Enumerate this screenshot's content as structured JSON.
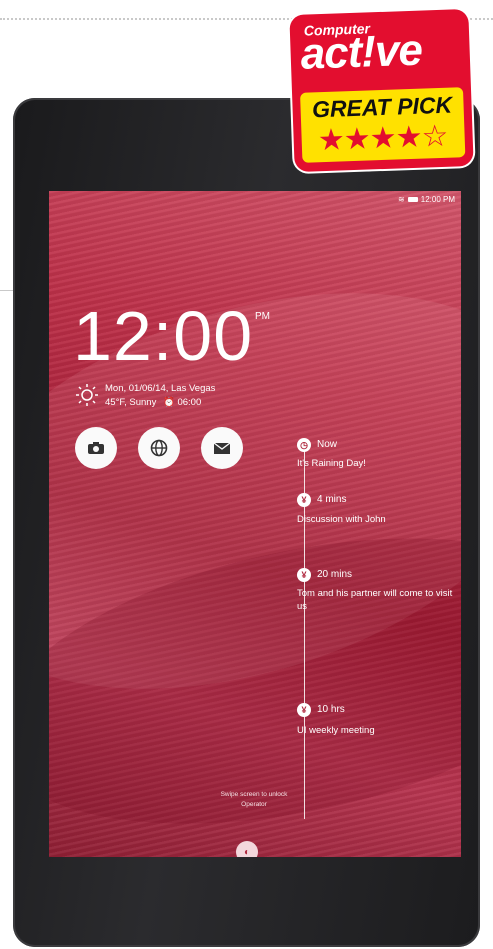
{
  "badge": {
    "brand_small": "Computer",
    "brand_large": "act!ve",
    "label": "GREAT PICK",
    "rating": 4,
    "rating_max": 5,
    "colors": {
      "red": "#e30e2f",
      "yellow": "#ffe100"
    }
  },
  "status_bar": {
    "time": "12:00 PM",
    "icons": [
      "wifi-icon",
      "battery-icon"
    ]
  },
  "lockscreen": {
    "clock": "12:00",
    "ampm": "PM",
    "date_location": "Mon, 01/06/14, Las Vegas",
    "weather": "45°F, Sunny",
    "alarm": "06:00",
    "weather_icon": "sun-icon",
    "quick_actions": [
      {
        "name": "camera",
        "icon": "camera-icon"
      },
      {
        "name": "browser",
        "icon": "globe-icon"
      },
      {
        "name": "mail",
        "icon": "mail-icon"
      }
    ],
    "events": [
      {
        "time": "Now",
        "desc": "It's Raining Day!",
        "icon": "clock-icon"
      },
      {
        "time": "4 mins",
        "desc": "Discussion with John",
        "icon": "event-icon"
      },
      {
        "time": "20 mins",
        "desc": "Tom and his partner will come to visit us",
        "icon": "event-icon"
      },
      {
        "time": "10 hrs",
        "desc": "UI weekly meeting",
        "icon": "event-icon"
      }
    ],
    "swipe_hint_1": "Swipe screen to unlock",
    "swipe_hint_2": "Operator",
    "accent_color": "#b02a40"
  }
}
